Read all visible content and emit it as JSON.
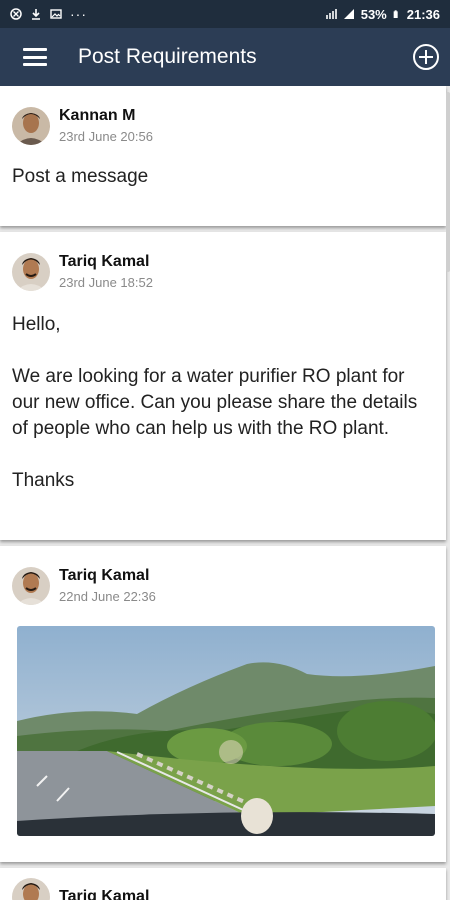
{
  "status_bar": {
    "left_icons": [
      "notification-icon",
      "download-icon",
      "image-icon",
      "more-dots-icon"
    ],
    "more_text": "···",
    "battery": "53%",
    "time": "21:36"
  },
  "app_bar": {
    "title": "Post Requirements",
    "menu_icon": "hamburger-menu-icon",
    "add_icon": "add-circle-icon"
  },
  "posts": [
    {
      "author": "Kannan M",
      "time": "23rd June 20:56",
      "lines": [
        "Post a message"
      ]
    },
    {
      "author": "Tariq Kamal",
      "time": "23rd June 18:52",
      "lines": [
        "Hello,",
        "",
        "We are looking for a water purifier RO plant for",
        "our new office. Can you please share the details",
        "of people who can help us with the RO plant.",
        "",
        "Thanks"
      ]
    },
    {
      "author": "Tariq Kamal",
      "time": "22nd June 22:36",
      "has_image": true
    },
    {
      "author": "Tariq Kamal"
    }
  ],
  "colors": {
    "status_bar": "#1f2d3d",
    "app_bar": "#2c3d55",
    "feed_background": "#e9e9e9"
  }
}
